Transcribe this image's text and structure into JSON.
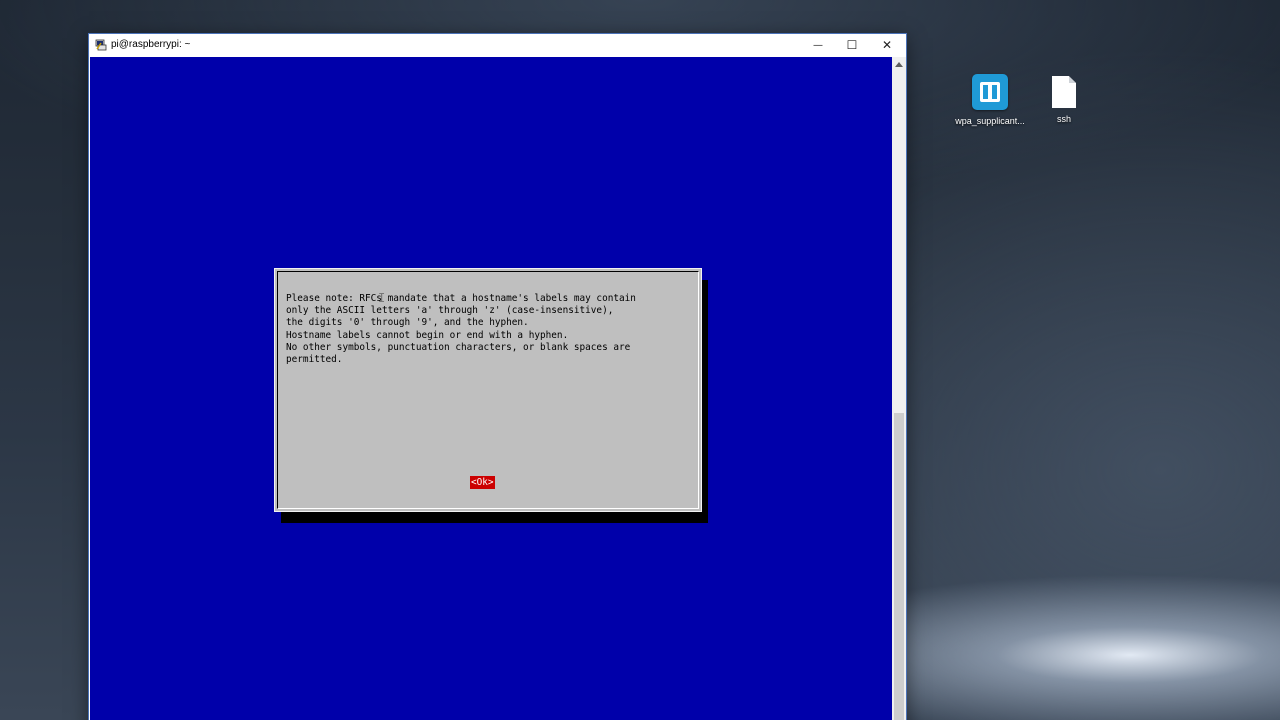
{
  "desktop": {
    "icons": [
      {
        "label": "wpa_supplicant...",
        "icon": "app-icon"
      },
      {
        "label": "ssh",
        "icon": "file-icon"
      }
    ]
  },
  "window": {
    "title": "pi@raspberrypi: ~",
    "controls": {
      "minimize": "—",
      "maximize": "☐",
      "close": "✕"
    }
  },
  "dialog": {
    "message": "Please note: RFCs mandate that a hostname's labels may contain\nonly the ASCII letters 'a' through 'z' (case-insensitive),\nthe digits '0' through '9', and the hyphen.\nHostname labels cannot begin or end with a hyphen.\nNo other symbols, punctuation characters, or blank spaces are\npermitted.",
    "ok_label": "<Ok>"
  },
  "colors": {
    "terminal_background": "#0000aa",
    "dialog_background": "#bfbfbf",
    "button_selected": "#cc0000"
  }
}
